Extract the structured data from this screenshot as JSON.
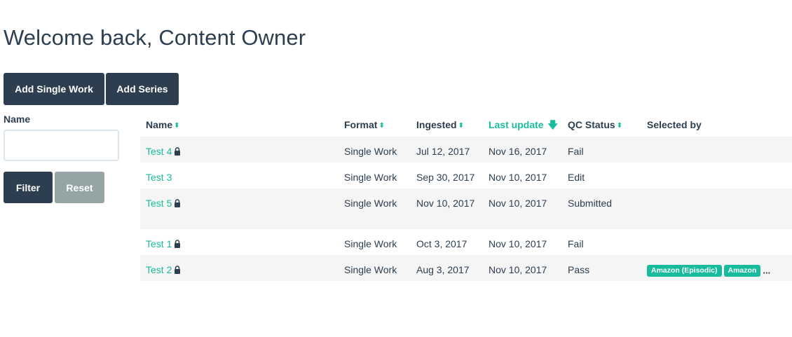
{
  "page": {
    "title": "Welcome back, Content Owner"
  },
  "actions": {
    "add_single_work": "Add Single Work",
    "add_series": "Add Series"
  },
  "filter": {
    "name_label": "Name",
    "name_value": "",
    "filter_label": "Filter",
    "reset_label": "Reset"
  },
  "table": {
    "headers": {
      "name": "Name",
      "format": "Format",
      "ingested": "Ingested",
      "last_update": "Last update",
      "qc_status": "QC Status",
      "selected_by": "Selected by"
    },
    "sort": {
      "active_column": "last_update",
      "direction": "descending"
    },
    "rows": [
      {
        "name": "Test 4",
        "locked": true,
        "format": "Single Work",
        "ingested": "Jul 12, 2017",
        "last_update": "Nov 16, 2017",
        "qc_status": "Fail",
        "selected_by": []
      },
      {
        "name": "Test 3",
        "locked": false,
        "format": "Single Work",
        "ingested": "Sep 30, 2017",
        "last_update": "Nov 10, 2017",
        "qc_status": "Edit",
        "selected_by": []
      },
      {
        "name": "Test 5",
        "locked": true,
        "format": "Single Work",
        "ingested": "Nov 10, 2017",
        "last_update": "Nov 10, 2017",
        "qc_status": "Submitted",
        "selected_by": []
      },
      {
        "name": "Test 1",
        "locked": true,
        "format": "Single Work",
        "ingested": "Oct 3, 2017",
        "last_update": "Nov 10, 2017",
        "qc_status": "Fail",
        "selected_by": []
      },
      {
        "name": "Test 2",
        "locked": true,
        "format": "Single Work",
        "ingested": "Aug 3, 2017",
        "last_update": "Nov 10, 2017",
        "qc_status": "Pass",
        "selected_by": [
          "Amazon (Episodic)",
          "Amazon"
        ],
        "selected_more": "..."
      }
    ]
  },
  "colors": {
    "primary": "#2c3e50",
    "accent": "#18bc9c",
    "muted": "#95a5a6",
    "stripe": "#f5f5f5"
  },
  "icons": {
    "lock": "lock-icon",
    "sort": "sort-icon",
    "sort_desc": "arrow-down-icon"
  }
}
